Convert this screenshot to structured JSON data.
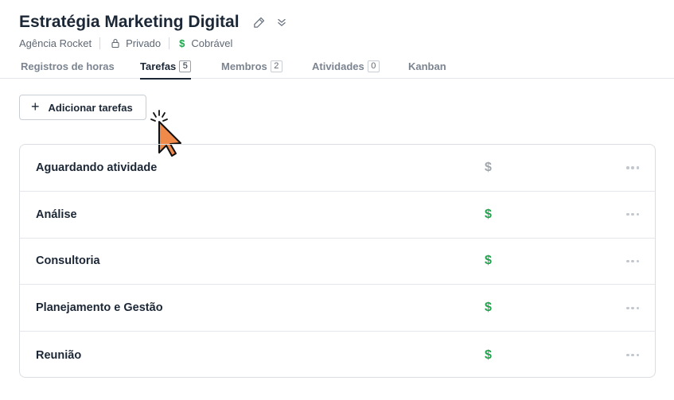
{
  "project": {
    "title": "Estratégia Marketing Digital",
    "client": "Agência Rocket",
    "privacy": "Privado",
    "billing": "Cobrável"
  },
  "icons": {
    "edit": "pencil-icon",
    "expand": "double-chevron-down-icon",
    "lock": "lock-icon",
    "billing": "dollar-icon",
    "more": "more-horizontal-icon"
  },
  "colors": {
    "billable": "#22a44e",
    "nonbillable": "#a0a6ae",
    "cursor_fill": "#f08a4b"
  },
  "tabs": [
    {
      "label": "Registros de horas",
      "count": null,
      "active": false
    },
    {
      "label": "Tarefas",
      "count": "5",
      "active": true
    },
    {
      "label": "Membros",
      "count": "2",
      "active": false
    },
    {
      "label": "Atividades",
      "count": "0",
      "active": false
    },
    {
      "label": "Kanban",
      "count": null,
      "active": false
    }
  ],
  "toolbar": {
    "add_label": "Adicionar tarefas",
    "add_icon": "+"
  },
  "tasks": [
    {
      "name": "Aguardando atividade",
      "billing_symbol": "$",
      "billable": false
    },
    {
      "name": "Análise",
      "billing_symbol": "$",
      "billable": true
    },
    {
      "name": "Consultoria",
      "billing_symbol": "$",
      "billable": true
    },
    {
      "name": "Planejamento e Gestão",
      "billing_symbol": "$",
      "billable": true
    },
    {
      "name": "Reunião",
      "billing_symbol": "$",
      "billable": true
    }
  ]
}
